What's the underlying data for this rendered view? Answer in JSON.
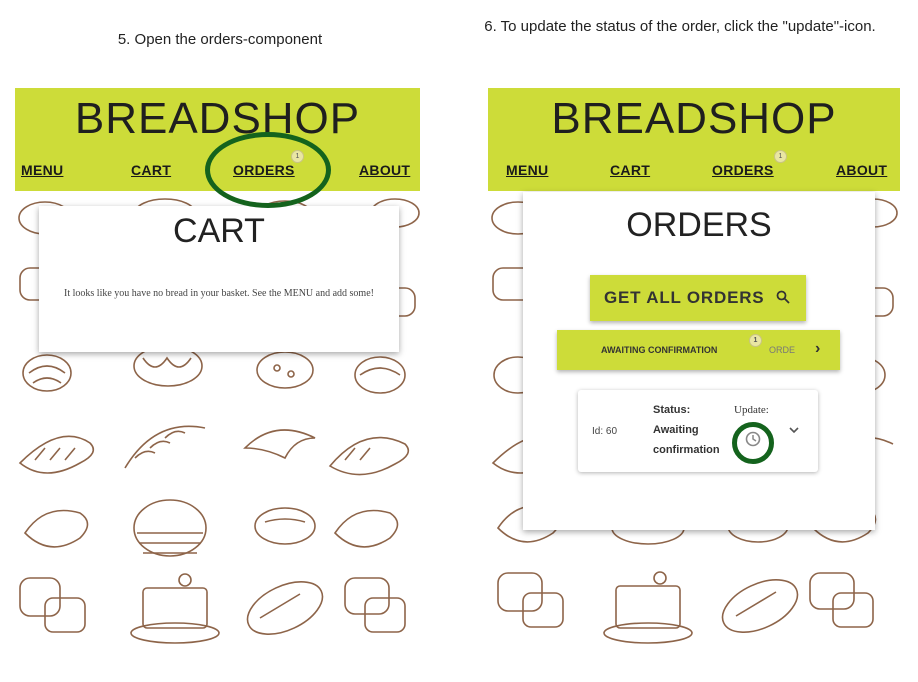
{
  "captions": {
    "step5": "5. Open the orders-component",
    "step6": "6. To update the status of the order, click the \"update\"-icon."
  },
  "brand": "BREADSHOP",
  "nav": {
    "menu": "MENU",
    "cart": "CART",
    "orders": "ORDERS",
    "about": "ABOUT",
    "orders_badge": "1"
  },
  "cart_view": {
    "title": "CART",
    "empty_message": "It looks like you have no bread in your basket. See the MENU and add some!"
  },
  "orders_view": {
    "title": "ORDERS",
    "get_all_button": "GET ALL ORDERS",
    "tabs": {
      "awaiting": "AWAITING CONFIRMATION",
      "awaiting_badge": "1",
      "next_partial": "ORDE",
      "next_arrow": "›"
    },
    "order": {
      "id_label": "Id: 60",
      "status_label": "Status:",
      "status_value_line1": "Awaiting",
      "status_value_line2": "confirmation",
      "update_label": "Update:"
    }
  },
  "colors": {
    "header": "#cddc39",
    "highlight_ring": "#14631d",
    "bread_line": "#7a4a2a"
  },
  "icons": {
    "search": "search-icon",
    "update": "update-icon",
    "expand": "chevron-down-icon",
    "next": "chevron-right-icon"
  }
}
